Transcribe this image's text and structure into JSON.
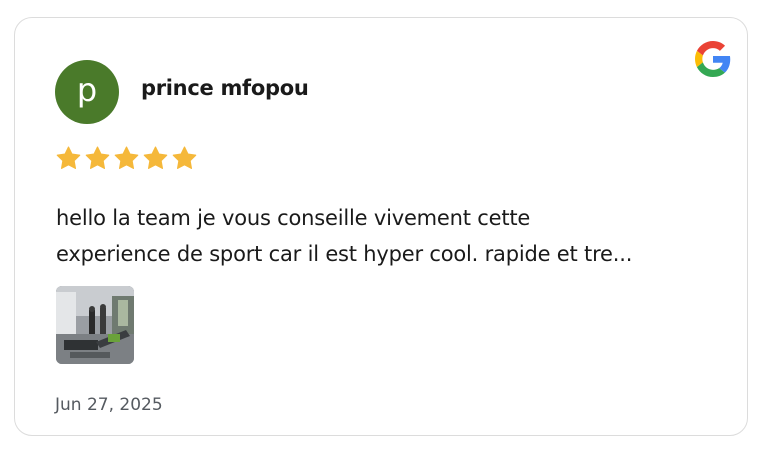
{
  "review": {
    "author_name": "prince mfopou",
    "avatar_initial": "p",
    "rating": 5,
    "rating_max": 5,
    "text_line_1": "hello la team je vous conseille vivement cette",
    "text_line_2": "experience de sport car il est hyper cool. rapide et tre...",
    "date": "Jun 27, 2025",
    "source_icon": "google-icon",
    "photo_icon": "review-photo-thumbnail"
  },
  "colors": {
    "avatar_bg": "#4a7a2a",
    "star": "#f5b83a",
    "text": "#1a1a1a",
    "date": "#555a60",
    "border": "#dcdcdc"
  }
}
